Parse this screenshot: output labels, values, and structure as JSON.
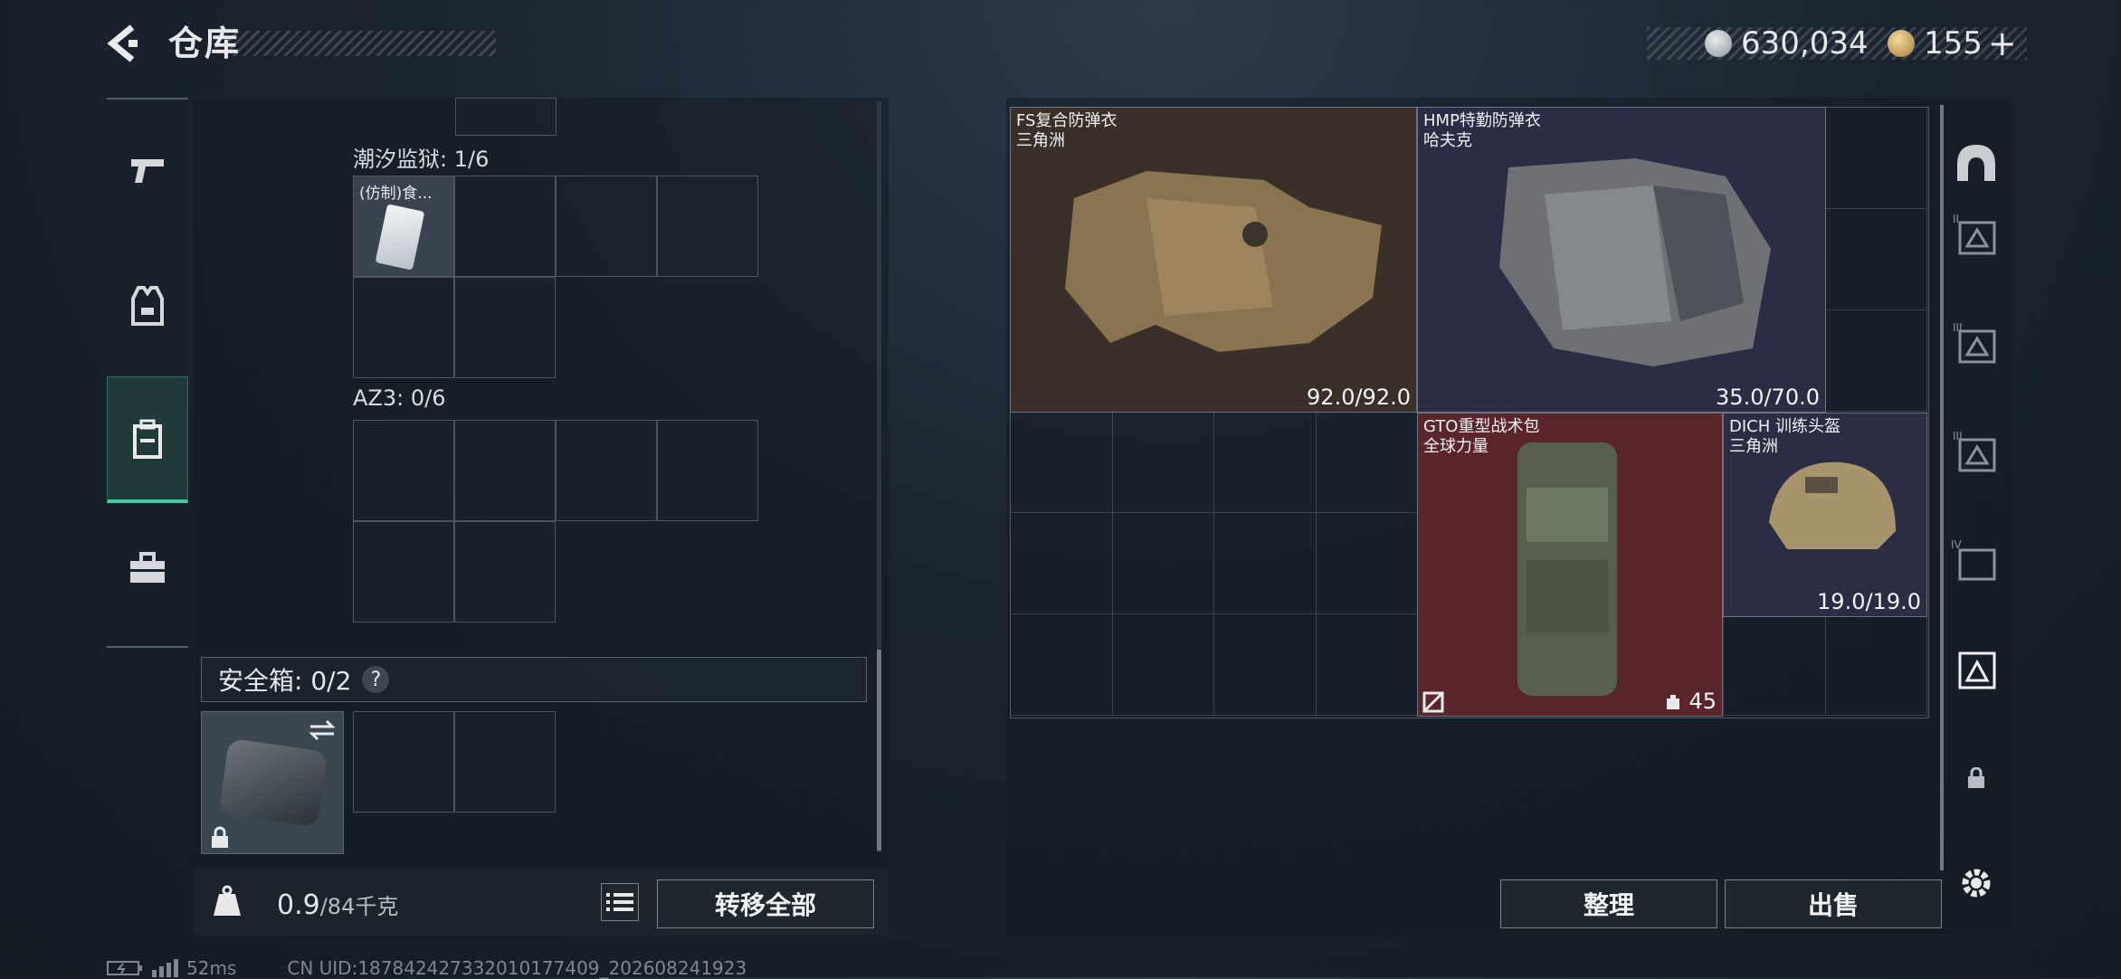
{
  "header": {
    "title": "仓库",
    "back_icon": "chevron-left-icon"
  },
  "currency": [
    {
      "name": "silver-coin-icon",
      "value": "630,034",
      "color": "#bfc6cc"
    },
    {
      "name": "gold-coin-icon",
      "value": "155",
      "add": "+",
      "color": "#d9b26a"
    }
  ],
  "sidebar": {
    "items": [
      {
        "icon": "pistol-icon",
        "active": false
      },
      {
        "icon": "vest-icon",
        "active": false
      },
      {
        "icon": "backpack-icon",
        "active": true
      },
      {
        "icon": "briefcase-icon",
        "active": false
      }
    ]
  },
  "left": {
    "containers": [
      {
        "label": "潮汐监狱: 1/6",
        "item_name": "(仿制)食..."
      },
      {
        "label": "AZ3: 0/6"
      }
    ],
    "safebox": {
      "label": "安全箱: 0/2",
      "help": "?"
    },
    "weight": {
      "value": "0.9",
      "capacity": "/84千克"
    },
    "transfer_all": "转移全部"
  },
  "right": {
    "items": [
      {
        "name": "FS复合防弹衣",
        "sub": "三角洲",
        "durability": "92.0/92.0",
        "color": "#3b2f29"
      },
      {
        "name": "HMP特勤防弹衣",
        "sub": "哈夫克",
        "durability": "35.0/70.0",
        "color": "#2a2d44"
      },
      {
        "name": "GTO重型战术包",
        "sub": "全球力量",
        "capacity": "45",
        "color": "#5b262b"
      },
      {
        "name": "DICH 训练头盔",
        "sub": "三角洲",
        "durability": "19.0/19.0",
        "color": "#2a2d44"
      }
    ],
    "sort_button": "整理",
    "sell_button": "出售"
  },
  "right_sidebar": [
    {
      "icon": "helmet-slot-icon",
      "label": ""
    },
    {
      "icon": "armor-slot-icon",
      "label": "II"
    },
    {
      "icon": "armor-slot-icon",
      "label": "III"
    },
    {
      "icon": "armor-slot-icon",
      "label": "III"
    },
    {
      "icon": "armor-slot-icon",
      "label": "IV"
    },
    {
      "icon": "armor-slot-icon",
      "label": ""
    },
    {
      "icon": "lock-icon",
      "label": ""
    },
    {
      "icon": "gear-icon",
      "label": ""
    }
  ],
  "status": {
    "ping": "52ms",
    "uid": "CN UID:187842427332010177409_202608241923"
  }
}
